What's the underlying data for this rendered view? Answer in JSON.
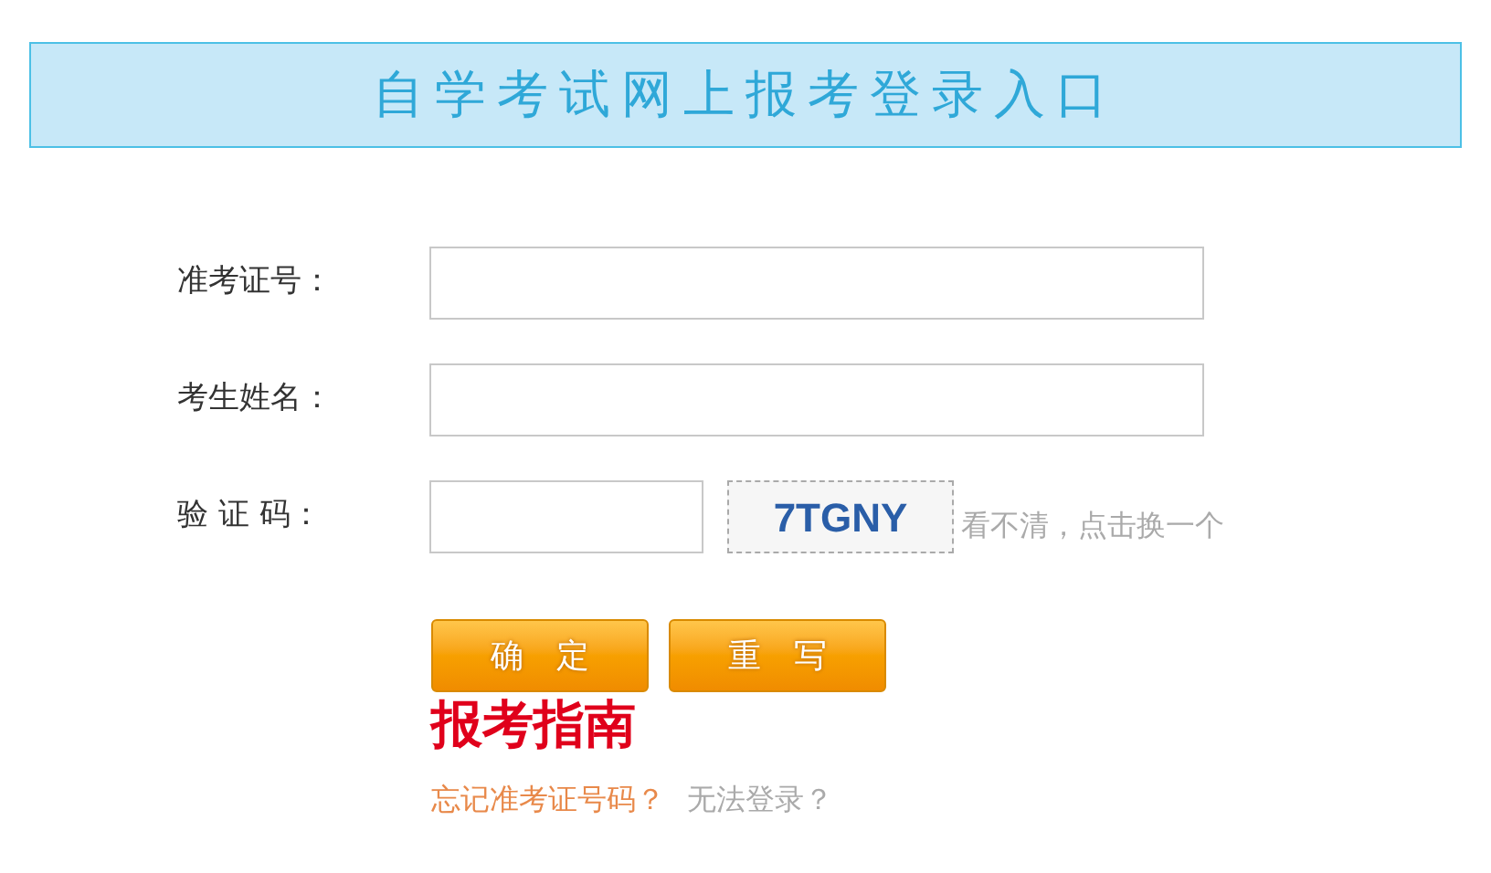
{
  "header": {
    "title": "自学考试网上报考登录入口"
  },
  "fields": [
    {
      "kind": "text",
      "label": "准考证号："
    },
    {
      "kind": "text",
      "label": "考生姓名："
    },
    {
      "kind": "captcha",
      "label": "验 证 码：",
      "captcha": "7TGNY",
      "refresh": "看不清，点击换一个"
    }
  ],
  "buttons": [
    "确　定",
    "重　写"
  ],
  "guide": "报考指南",
  "links": [
    "忘记准考证号码？",
    "无法登录？"
  ]
}
